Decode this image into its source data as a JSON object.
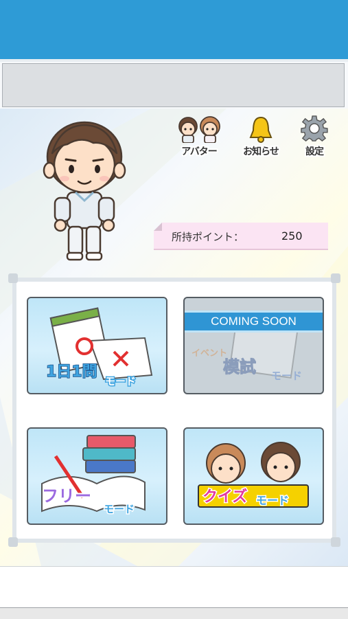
{
  "header": {
    "color": "#2e9bd6"
  },
  "menu": {
    "avatar_label": "アバター",
    "notice_label": "お知らせ",
    "settings_label": "設定"
  },
  "points": {
    "label": "所持ポイント：",
    "value": "250"
  },
  "modes": {
    "daily": {
      "line1": "1日1問",
      "line2": "モード"
    },
    "event_exam": {
      "badge": "COMING SOON",
      "line0": "イベント",
      "line1": "模試",
      "line2": "モード"
    },
    "free": {
      "line1": "フリー",
      "line2": "モード"
    },
    "quiz": {
      "line1": "クイズ",
      "line2": "モード"
    }
  }
}
